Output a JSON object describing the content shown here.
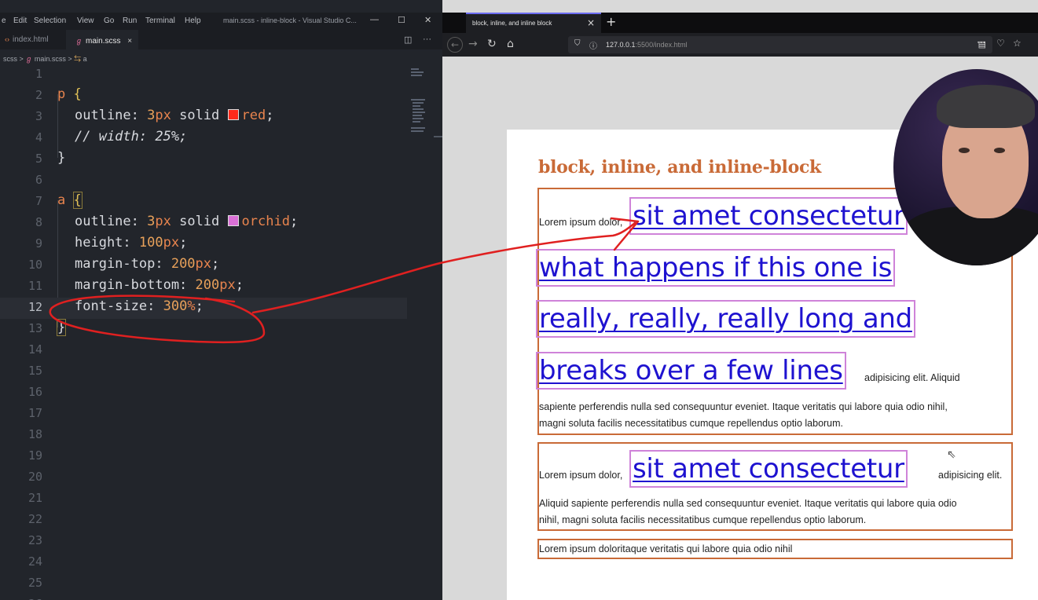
{
  "vscode": {
    "menu": [
      "e",
      "Edit",
      "Selection",
      "View",
      "Go",
      "Run",
      "Terminal",
      "Help"
    ],
    "window_title": "main.scss - inline-block - Visual Studio C...",
    "tabs": [
      {
        "label": "index.html",
        "icon": "html-file-icon"
      },
      {
        "label": "main.scss",
        "icon": "sass-file-icon",
        "close": "×"
      }
    ],
    "breadcrumb": {
      "folder": "scss",
      "sep": ">",
      "file": "main.scss",
      "symbol": "a"
    },
    "lines": [
      {
        "n": "1"
      },
      {
        "n": "2"
      },
      {
        "n": "3"
      },
      {
        "n": "4"
      },
      {
        "n": "5"
      },
      {
        "n": "6"
      },
      {
        "n": "7"
      },
      {
        "n": "8"
      },
      {
        "n": "9"
      },
      {
        "n": "10"
      },
      {
        "n": "11"
      },
      {
        "n": "12"
      },
      {
        "n": "13"
      },
      {
        "n": "14"
      },
      {
        "n": "15"
      },
      {
        "n": "16"
      },
      {
        "n": "17"
      },
      {
        "n": "18"
      },
      {
        "n": "19"
      },
      {
        "n": "20"
      },
      {
        "n": "21"
      },
      {
        "n": "22"
      },
      {
        "n": "23"
      },
      {
        "n": "24"
      },
      {
        "n": "25"
      },
      {
        "n": "26"
      }
    ],
    "code": {
      "l2_sel": "p",
      "l2_brace": "{",
      "l3_prop": "outline: ",
      "l3_num": "3",
      "l3_unit": "px",
      "l3_rest": " solid ",
      "l3_color": "red",
      "l3_end": ";",
      "l4_comment": "// width: 25%;",
      "l5_brace": "}",
      "l7_sel": "a",
      "l7_brace": "{",
      "l8_prop": "outline: ",
      "l8_num": "3",
      "l8_unit": "px",
      "l8_rest": " solid ",
      "l8_color": "orchid",
      "l8_end": ";",
      "l9_prop": "height: ",
      "l9_num": "100",
      "l9_unit": "px",
      "l9_end": ";",
      "l10_prop": "margin-top: ",
      "l10_num": "200",
      "l10_unit": "px",
      "l10_end": ";",
      "l11_prop": "margin-bottom: ",
      "l11_num": "200",
      "l11_unit": "px",
      "l11_end": ";",
      "l12_prop": "font-size: ",
      "l12_num": "300",
      "l12_unit": "%",
      "l12_end": ";",
      "l13_brace": "}"
    },
    "swatch_colors": {
      "red": "#ff2a1a",
      "orchid": "#da70d6"
    }
  },
  "browser": {
    "tab_title": "block, inline, and inline block",
    "tab_close": "×",
    "new_tab": "+",
    "url_host": "127.0.0.1",
    "url_path": ":5500/index.html",
    "page": {
      "title": "block, inline, and inline-block",
      "box1": {
        "before": "Lorem ipsum dolor,",
        "link_lines": [
          "sit amet consectetur",
          "what happens if this one is",
          "really, really, really long and",
          "breaks over a few lines"
        ],
        "after": "adipisicing elit. Aliquid",
        "line2": "sapiente perferendis nulla sed consequuntur eveniet. Itaque veritatis qui labore quia odio nihil,",
        "line3": "magni soluta facilis necessitatibus cumque repellendus optio laborum."
      },
      "box2": {
        "before": "Lorem ipsum dolor,",
        "link": "sit amet consectetur",
        "after": "adipisicing elit.",
        "line2": "Aliquid sapiente perferendis nulla sed consequuntur eveniet. Itaque veritatis qui labore quia odio",
        "line3": "nihil, magni soluta facilis necessitatibus cumque repellendus optio laborum."
      },
      "box3": {
        "text": "Lorem ipsum doloritaque veritatis qui labore quia odio nihil"
      }
    },
    "colors": {
      "heading": "#c96a37",
      "link": "#1e12d0",
      "link_outline": "#cf83d9",
      "box_outline": "#c96a37"
    }
  },
  "annotation": {
    "color": "#e02020"
  }
}
